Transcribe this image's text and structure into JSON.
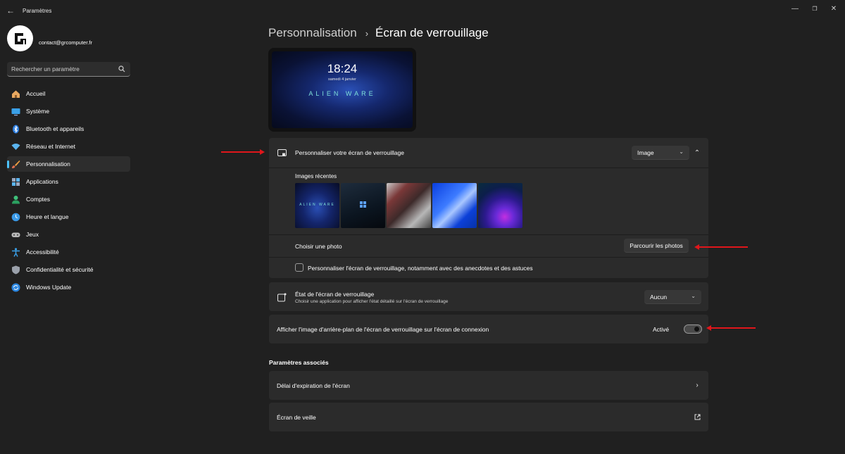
{
  "titlebar": {
    "title": "Paramètres"
  },
  "profile": {
    "email": "contact@grcomputer.fr"
  },
  "search": {
    "placeholder": "Rechercher un paramètre"
  },
  "sidebar": {
    "items": [
      {
        "label": "Accueil",
        "icon": "home-icon"
      },
      {
        "label": "Système",
        "icon": "monitor-icon"
      },
      {
        "label": "Bluetooth et appareils",
        "icon": "bluetooth-icon"
      },
      {
        "label": "Réseau et Internet",
        "icon": "wifi-icon"
      },
      {
        "label": "Personnalisation",
        "icon": "brush-icon",
        "active": true
      },
      {
        "label": "Applications",
        "icon": "apps-icon"
      },
      {
        "label": "Comptes",
        "icon": "person-icon"
      },
      {
        "label": "Heure et langue",
        "icon": "globe-clock-icon"
      },
      {
        "label": "Jeux",
        "icon": "gamepad-icon"
      },
      {
        "label": "Accessibilité",
        "icon": "accessibility-icon"
      },
      {
        "label": "Confidentialité et sécurité",
        "icon": "shield-icon"
      },
      {
        "label": "Windows Update",
        "icon": "update-icon"
      }
    ]
  },
  "breadcrumb": {
    "parent": "Personnalisation",
    "separator": "›",
    "current": "Écran de verrouillage"
  },
  "preview": {
    "time": "18:24",
    "date": "samedi 4 janvier",
    "brand": "ALIEN WARE"
  },
  "personalize": {
    "title": "Personnaliser votre écran de verrouillage",
    "dropdown_value": "Image",
    "recent_label": "Images récentes",
    "thumb_brand": "ALIEN WARE",
    "choose_label": "Choisir une photo",
    "browse_button": "Parcourir les photos",
    "tips_checkbox_label": "Personnaliser l'écran de verrouillage, notamment avec des anecdotes et des astuces"
  },
  "status": {
    "title": "État de l'écran de verrouillage",
    "subtitle": "Choisir une application pour afficher l'état détaillé sur l'écran de verrouillage",
    "dropdown_value": "Aucun"
  },
  "signin_background": {
    "title": "Afficher l'image d'arrière-plan de l'écran de verrouillage sur l'écran de connexion",
    "state_label": "Activé",
    "enabled": true
  },
  "related": {
    "heading": "Paramètres associés",
    "items": [
      {
        "label": "Délai d'expiration de l'écran",
        "icon": "chevron-right-icon"
      },
      {
        "label": "Écran de veille",
        "icon": "external-link-icon"
      }
    ]
  },
  "colors": {
    "accent": "#4cc2ff",
    "annotation_arrow": "#e0161b",
    "background": "#202020",
    "card": "#2b2b2b"
  }
}
